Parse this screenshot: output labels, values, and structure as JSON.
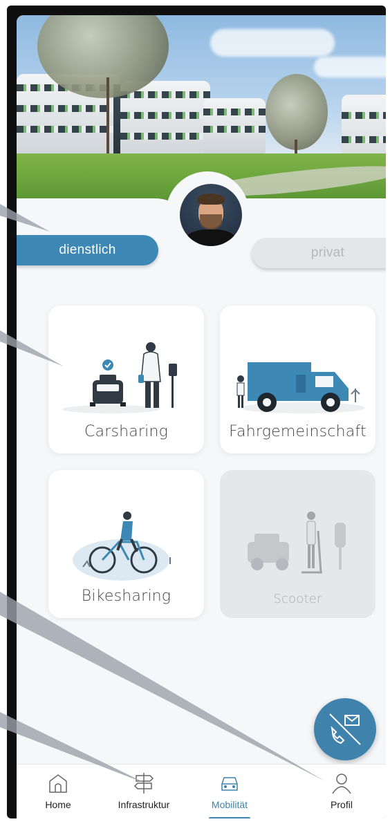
{
  "toggle": {
    "active_label": "dienstlich",
    "inactive_label": "privat"
  },
  "tiles": [
    {
      "label": "Carsharing",
      "enabled": true,
      "illustration": "carsharing-illustration"
    },
    {
      "label": "Fahrgemeinschaft",
      "enabled": true,
      "illustration": "van-illustration"
    },
    {
      "label": "Bikesharing",
      "enabled": true,
      "illustration": "bicycle-illustration"
    },
    {
      "label": "Scooter",
      "enabled": false,
      "illustration": "scooter-illustration"
    }
  ],
  "fab": {
    "icon": "phone-mail-icon"
  },
  "nav": {
    "items": [
      {
        "label": "Home",
        "icon": "home-icon"
      },
      {
        "label": "Infrastruktur",
        "icon": "signpost-icon"
      },
      {
        "label": "Mobilität",
        "icon": "car-icon",
        "active": true
      },
      {
        "label": "Profil",
        "icon": "profile-icon"
      }
    ]
  },
  "colors": {
    "accent": "#3e88b5",
    "tile_disabled": "#e6e7e9",
    "background": "#f6f7f8"
  }
}
